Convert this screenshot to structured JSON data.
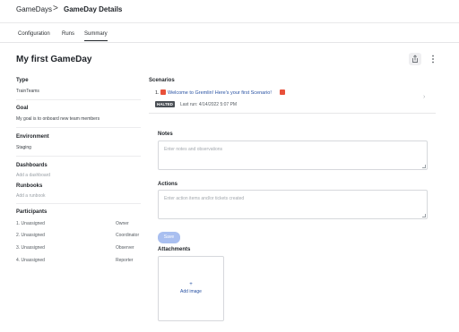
{
  "breadcrumb": {
    "root": "GameDays",
    "separator": ">",
    "current": "GameDay Details"
  },
  "tabs": [
    {
      "label": "Configuration",
      "active": false
    },
    {
      "label": "Runs",
      "active": false
    },
    {
      "label": "Summary",
      "active": true
    }
  ],
  "page": {
    "title": "My first GameDay"
  },
  "details": {
    "type_label": "Type",
    "type_value": "TrainTeams",
    "goal_label": "Goal",
    "goal_value": "My goal is to onboard new team members",
    "environment_label": "Environment",
    "environment_value": "Staging",
    "dashboards_label": "Dashboards",
    "dashboards_add": "Add a dashboard",
    "runbooks_label": "Runbooks",
    "runbooks_add": "Add a runbook",
    "participants_label": "Participants",
    "participants": [
      {
        "name": "1. Unassigned",
        "role": "Owner"
      },
      {
        "name": "2. Unassigned",
        "role": "Coordinator"
      },
      {
        "name": "3. Unassigned",
        "role": "Observer"
      },
      {
        "name": "4. Unassigned",
        "role": "Reporter"
      }
    ]
  },
  "scenarios": {
    "label": "Scenarios",
    "items": [
      {
        "number": "1.",
        "title": "Welcome to Gremlin! Here's your first Scenario!",
        "status": "HALTED",
        "last_run": "Last run: 4/14/2022 5:07 PM"
      }
    ]
  },
  "notes": {
    "label": "Notes",
    "placeholder": "Enter notes and observations"
  },
  "actions": {
    "label": "Actions",
    "placeholder": "Enter action items and/or tickets created"
  },
  "save_label": "Save",
  "attachments": {
    "label": "Attachments",
    "plus": "+",
    "add_label": "Add image"
  },
  "colors": {
    "accent": "#2952a3",
    "save_button": "#a9bff0",
    "badge": "#4a4f55"
  },
  "icons": {
    "share": "share-icon",
    "more": "more-vertical-icon",
    "chevron": "chevron-right-icon",
    "gift": "gift-emoji-icon"
  }
}
